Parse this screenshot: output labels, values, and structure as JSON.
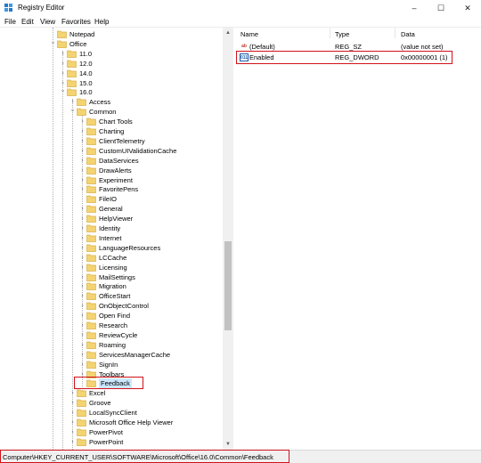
{
  "window": {
    "title": "Registry Editor",
    "controls": {
      "minimize": "–",
      "maximize": "☐",
      "close": "✕"
    },
    "icon": "registry-icon"
  },
  "menu": [
    "File",
    "Edit",
    "View",
    "Favorites",
    "Help"
  ],
  "tree": [
    {
      "label": "Notepad",
      "depth": 0,
      "state": "leaf"
    },
    {
      "label": "Office",
      "depth": 0,
      "state": "expanded"
    },
    {
      "label": "11.0",
      "depth": 1,
      "state": "collapsed"
    },
    {
      "label": "12.0",
      "depth": 1,
      "state": "collapsed"
    },
    {
      "label": "14.0",
      "depth": 1,
      "state": "collapsed"
    },
    {
      "label": "15.0",
      "depth": 1,
      "state": "collapsed"
    },
    {
      "label": "16.0",
      "depth": 1,
      "state": "expanded"
    },
    {
      "label": "Access",
      "depth": 2,
      "state": "collapsed"
    },
    {
      "label": "Common",
      "depth": 2,
      "state": "expanded"
    },
    {
      "label": "Chart Tools",
      "depth": 3,
      "state": "collapsed"
    },
    {
      "label": "Charting",
      "depth": 3,
      "state": "collapsed"
    },
    {
      "label": "ClientTelemetry",
      "depth": 3,
      "state": "collapsed"
    },
    {
      "label": "CustomUIValidationCache",
      "depth": 3,
      "state": "collapsed"
    },
    {
      "label": "DataServices",
      "depth": 3,
      "state": "collapsed"
    },
    {
      "label": "DrawAlerts",
      "depth": 3,
      "state": "collapsed"
    },
    {
      "label": "Experiment",
      "depth": 3,
      "state": "collapsed"
    },
    {
      "label": "FavoritePens",
      "depth": 3,
      "state": "collapsed"
    },
    {
      "label": "FileIO",
      "depth": 3,
      "state": "leaf"
    },
    {
      "label": "General",
      "depth": 3,
      "state": "collapsed"
    },
    {
      "label": "HelpViewer",
      "depth": 3,
      "state": "collapsed"
    },
    {
      "label": "Identity",
      "depth": 3,
      "state": "collapsed"
    },
    {
      "label": "Internet",
      "depth": 3,
      "state": "collapsed"
    },
    {
      "label": "LanguageResources",
      "depth": 3,
      "state": "collapsed"
    },
    {
      "label": "LCCache",
      "depth": 3,
      "state": "collapsed"
    },
    {
      "label": "Licensing",
      "depth": 3,
      "state": "collapsed"
    },
    {
      "label": "MailSettings",
      "depth": 3,
      "state": "collapsed"
    },
    {
      "label": "Migration",
      "depth": 3,
      "state": "collapsed"
    },
    {
      "label": "OfficeStart",
      "depth": 3,
      "state": "collapsed"
    },
    {
      "label": "OnObjectControl",
      "depth": 3,
      "state": "collapsed"
    },
    {
      "label": "Open Find",
      "depth": 3,
      "state": "collapsed"
    },
    {
      "label": "Research",
      "depth": 3,
      "state": "collapsed"
    },
    {
      "label": "ReviewCycle",
      "depth": 3,
      "state": "collapsed"
    },
    {
      "label": "Roaming",
      "depth": 3,
      "state": "collapsed"
    },
    {
      "label": "ServicesManagerCache",
      "depth": 3,
      "state": "collapsed"
    },
    {
      "label": "SignIn",
      "depth": 3,
      "state": "collapsed"
    },
    {
      "label": "Toolbars",
      "depth": 3,
      "state": "collapsed"
    },
    {
      "label": "Feedback",
      "depth": 3,
      "state": "leaf",
      "selected": true
    },
    {
      "label": "Excel",
      "depth": 2,
      "state": "collapsed"
    },
    {
      "label": "Groove",
      "depth": 2,
      "state": "collapsed"
    },
    {
      "label": "LocalSyncClient",
      "depth": 2,
      "state": "collapsed"
    },
    {
      "label": "Microsoft Office Help Viewer",
      "depth": 2,
      "state": "collapsed"
    },
    {
      "label": "PowerPivot",
      "depth": 2,
      "state": "collapsed"
    },
    {
      "label": "PowerPoint",
      "depth": 2,
      "state": "collapsed"
    }
  ],
  "values": {
    "columns": [
      "Name",
      "Type",
      "Data"
    ],
    "rows": [
      {
        "icon": "string-value-icon",
        "icon_text": "ab",
        "name": "(Default)",
        "type": "REG_SZ",
        "data": "(value not set)"
      },
      {
        "icon": "dword-value-icon",
        "icon_text": "011",
        "name": "Enabled",
        "type": "REG_DWORD",
        "data": "0x00000001 (1)",
        "highlighted": true
      }
    ]
  },
  "status": {
    "path": "Computer\\HKEY_CURRENT_USER\\SOFTWARE\\Microsoft\\Office\\16.0\\Common\\Feedback"
  },
  "colors": {
    "highlight": "#d0121a",
    "folder": "#f4d372",
    "folder_edge": "#d9b24a",
    "selection": "#cce8ff"
  }
}
